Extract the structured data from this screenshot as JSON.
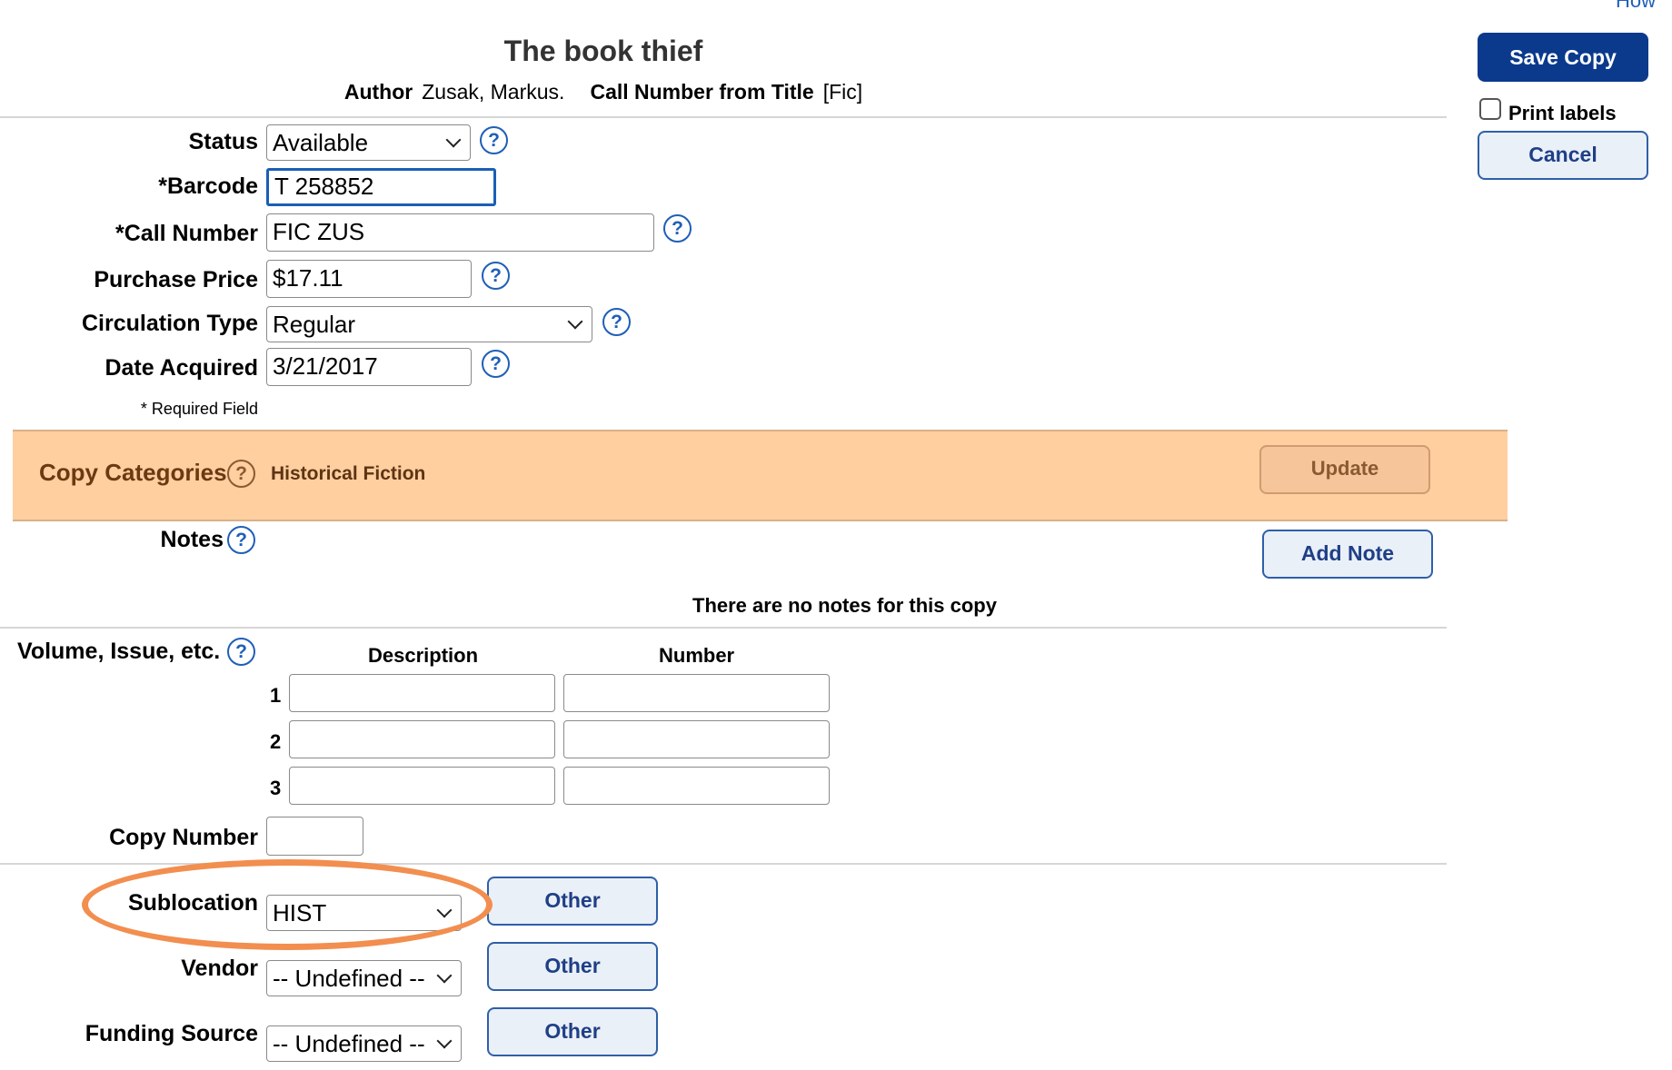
{
  "top_link": "How",
  "book": {
    "title": "The book thief",
    "author_label": "Author",
    "author": "Zusak, Markus.",
    "call_from_title_label": "Call Number from Title",
    "call_from_title": "[Fic]"
  },
  "actions": {
    "save": "Save Copy",
    "print_labels": "Print labels",
    "cancel": "Cancel"
  },
  "form": {
    "status": {
      "label": "Status",
      "value": "Available"
    },
    "barcode": {
      "label": "*Barcode",
      "value": "T 258852"
    },
    "call_number": {
      "label": "*Call Number",
      "value": "FIC ZUS"
    },
    "purchase_price": {
      "label": "Purchase Price",
      "value": "$17.11"
    },
    "circulation_type": {
      "label": "Circulation Type",
      "value": "Regular"
    },
    "date_acquired": {
      "label": "Date Acquired",
      "value": "3/21/2017"
    },
    "required_note": "* Required Field"
  },
  "categories": {
    "label": "Copy Categories",
    "value": "Historical Fiction",
    "update": "Update"
  },
  "notes": {
    "label": "Notes",
    "add": "Add Note",
    "empty": "There are no notes for this copy"
  },
  "volume": {
    "label": "Volume, Issue, etc.",
    "col_desc": "Description",
    "col_num": "Number",
    "rows": [
      {
        "n": "1",
        "desc": "",
        "num": ""
      },
      {
        "n": "2",
        "desc": "",
        "num": ""
      },
      {
        "n": "3",
        "desc": "",
        "num": ""
      }
    ]
  },
  "copy_number": {
    "label": "Copy Number",
    "value": ""
  },
  "sublocation": {
    "label": "Sublocation",
    "value": "HIST",
    "other": "Other"
  },
  "vendor": {
    "label": "Vendor",
    "value": "-- Undefined --",
    "other": "Other"
  },
  "funding": {
    "label": "Funding Source",
    "value": "-- Undefined --",
    "other": "Other"
  },
  "help_glyph": "?",
  "colors": {
    "primary": "#0b3a8c",
    "band": "#ffcfa0",
    "highlight": "#f28e4f",
    "help": "#1f5fb8"
  }
}
